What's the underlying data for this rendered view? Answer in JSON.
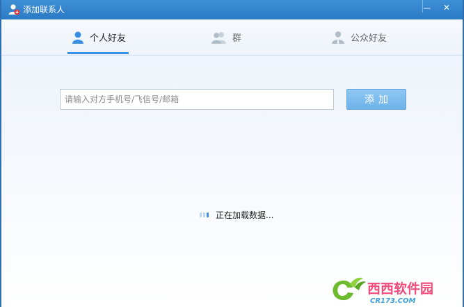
{
  "window": {
    "title": "添加联系人",
    "minimize_symbol": "—",
    "close_symbol": "✕"
  },
  "tabs": [
    {
      "label": "个人好友",
      "icon": "person-icon",
      "active": true
    },
    {
      "label": "群",
      "icon": "group-icon",
      "active": false
    },
    {
      "label": "公众好友",
      "icon": "public-account-icon",
      "active": false
    }
  ],
  "search": {
    "placeholder": "请输入对方手机号/飞信号/邮箱",
    "value": ""
  },
  "add_button": {
    "label": "添加"
  },
  "status": {
    "loading_text": "正在加载数据..."
  },
  "watermark": {
    "brand": "西西软件园",
    "site": "CR173.COM"
  },
  "colors": {
    "titlebar": "#2f7fc6",
    "accent": "#3a8fe0",
    "button": "#7bbbed"
  }
}
